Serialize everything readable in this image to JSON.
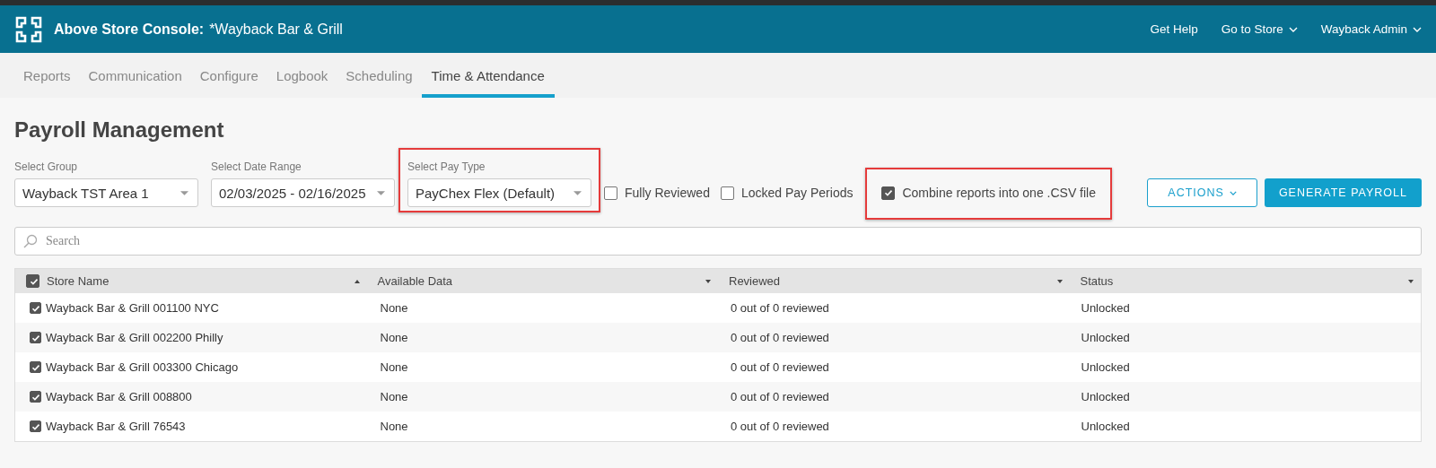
{
  "header": {
    "app_name": "Above Store Console:",
    "store_name": "*Wayback Bar & Grill",
    "links": [
      {
        "label": "Get Help",
        "dropdown": false
      },
      {
        "label": "Go to Store",
        "dropdown": true
      },
      {
        "label": "Wayback Admin",
        "dropdown": true
      }
    ]
  },
  "nav_tabs": [
    {
      "label": "Reports",
      "selected": false
    },
    {
      "label": "Communication",
      "selected": false
    },
    {
      "label": "Configure",
      "selected": false
    },
    {
      "label": "Logbook",
      "selected": false
    },
    {
      "label": "Scheduling",
      "selected": false
    },
    {
      "label": "Time & Attendance",
      "selected": true
    }
  ],
  "page_title": "Payroll Management",
  "filters": [
    {
      "label": "Select Group",
      "value": "Wayback TST Area 1",
      "highlighted": false
    },
    {
      "label": "Select Date Range",
      "value": "02/03/2025 - 02/16/2025",
      "highlighted": false
    },
    {
      "label": "Select Pay Type",
      "value": "PayChex Flex (Default)",
      "highlighted": true
    }
  ],
  "options": [
    {
      "label": "Fully Reviewed",
      "checked": false,
      "highlighted": false
    },
    {
      "label": "Locked Pay Periods",
      "checked": false,
      "highlighted": false
    },
    {
      "label": "Combine reports into one .CSV file",
      "checked": true,
      "highlighted": true
    }
  ],
  "actions_button": "ACTIONS",
  "generate_button": "GENERATE PAYROLL",
  "search": {
    "placeholder": "Search"
  },
  "table": {
    "all_checked": true,
    "columns": [
      {
        "label": "Store Name",
        "sorted_ascending": true
      },
      {
        "label": "Available Data",
        "sorted_ascending": false
      },
      {
        "label": "Reviewed",
        "sorted_ascending": false
      },
      {
        "label": "Status",
        "sorted_ascending": false
      }
    ],
    "rows": [
      {
        "checked": true,
        "cells": [
          "Wayback Bar & Grill 001100 NYC",
          "None",
          "0 out of 0 reviewed",
          "Unlocked"
        ]
      },
      {
        "checked": true,
        "cells": [
          "Wayback Bar & Grill 002200 Philly",
          "None",
          "0 out of 0 reviewed",
          "Unlocked"
        ]
      },
      {
        "checked": true,
        "cells": [
          "Wayback Bar & Grill 003300 Chicago",
          "None",
          "0 out of 0 reviewed",
          "Unlocked"
        ]
      },
      {
        "checked": true,
        "cells": [
          "Wayback Bar & Grill 008800",
          "None",
          "0 out of 0 reviewed",
          "Unlocked"
        ]
      },
      {
        "checked": true,
        "cells": [
          "Wayback Bar & Grill 76543",
          "None",
          "0 out of 0 reviewed",
          "Unlocked"
        ]
      }
    ]
  }
}
